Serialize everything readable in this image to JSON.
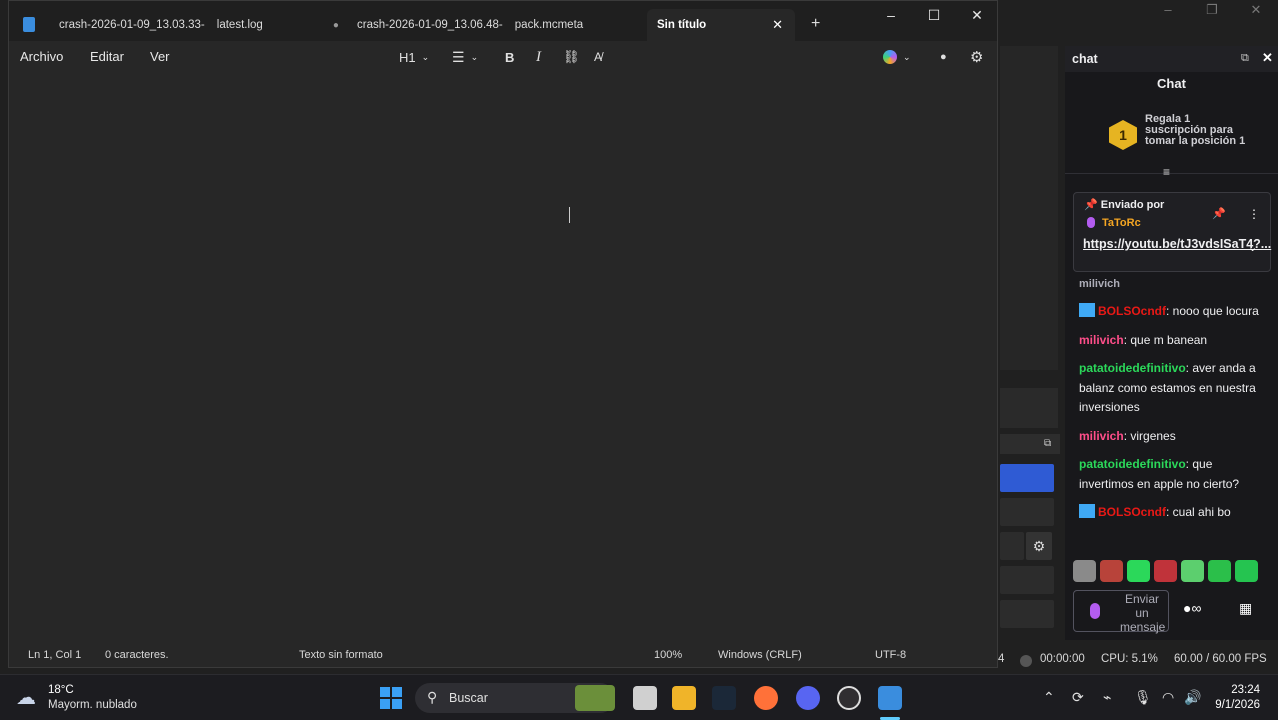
{
  "notepad": {
    "tabs": [
      {
        "title": "crash-2026-01-09_13.03.33-",
        "subtitle": "latest.log"
      },
      {
        "title": "crash-2026-01-09_13.06.48-",
        "subtitle": "pack.mcmeta"
      },
      {
        "title": "Sin título"
      }
    ],
    "menu": {
      "file": "Archivo",
      "edit": "Editar",
      "view": "Ver"
    },
    "toolbar": {
      "heading": "H1"
    },
    "status": {
      "position": "Ln 1, Col 1",
      "chars": "0 caracteres.",
      "format": "Texto sin formato",
      "zoom": "100%",
      "line_endings": "Windows (CRLF)",
      "encoding": "UTF-8"
    }
  },
  "obs": {
    "time": "00:00:00",
    "cpu": "CPU: 5.1%",
    "fps": "60.00 / 60.00 FPS",
    "scene_num": "4"
  },
  "chat": {
    "dock_title": "chat",
    "header": "Chat",
    "gift": {
      "badge": "1",
      "text": "Regala 1 suscripción para tomar la posición 1"
    },
    "pinned": {
      "label": "Enviado por",
      "user": "TaToRc",
      "link": "https://youtu.be/tJ3vdsISaT4?...",
      "pinned_by": "milivich"
    },
    "messages": [
      {
        "user": "BOLSOcndf",
        "color": "#e91916",
        "badge": true,
        "text": ": nooo que locura"
      },
      {
        "user": "milivich",
        "color": "#ff4e8a",
        "badge": false,
        "text": ": que m banean"
      },
      {
        "user": "patatoidedefinitivo",
        "color": "#2bd85a",
        "badge": false,
        "text": ": aver anda a balanz como estamos en nuestra inversiones"
      },
      {
        "user": "milivich",
        "color": "#ff4e8a",
        "badge": false,
        "text": ": virgenes"
      },
      {
        "user": "patatoidedefinitivo",
        "color": "#2bd85a",
        "badge": false,
        "text": ": que invertimos en apple no cierto?"
      },
      {
        "user": "BOLSOcndf",
        "color": "#e91916",
        "badge": true,
        "text": ": cual ahi bo"
      }
    ],
    "input_placeholder": "Enviar un mensaje"
  },
  "taskbar": {
    "weather_temp": "18°C",
    "weather_desc": "Mayorm. nublado",
    "search_label": "Buscar",
    "time": "23:24",
    "date": "9/1/2026"
  }
}
